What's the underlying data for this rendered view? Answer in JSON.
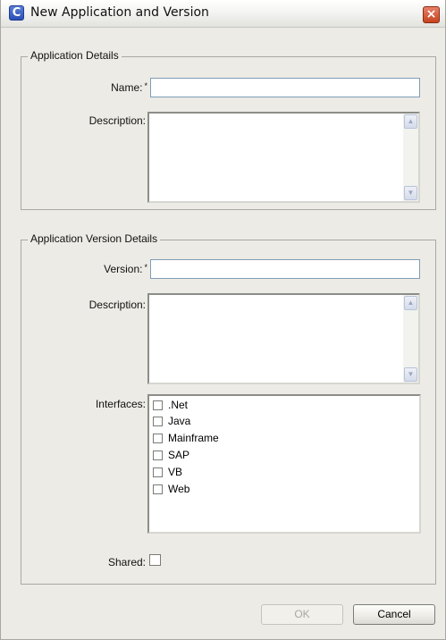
{
  "window": {
    "title": "New Application and Version",
    "icon_glyph": "C",
    "close_glyph": "×"
  },
  "app_details": {
    "group_title": "Application Details",
    "name_label": "Name:",
    "name_value": "",
    "description_label": "Description:",
    "description_value": ""
  },
  "version_details": {
    "group_title": "Application Version Details",
    "version_label": "Version:",
    "version_value": "",
    "description_label": "Description:",
    "description_value": "",
    "interfaces_label": "Interfaces:",
    "interfaces": [
      {
        "label": ".Net",
        "checked": false
      },
      {
        "label": "Java",
        "checked": false
      },
      {
        "label": "Mainframe",
        "checked": false
      },
      {
        "label": "SAP",
        "checked": false
      },
      {
        "label": "VB",
        "checked": false
      },
      {
        "label": "Web",
        "checked": false
      }
    ],
    "shared_label": "Shared:",
    "shared_checked": false
  },
  "required_marker": "*",
  "scroll_up_glyph": "▲",
  "scroll_down_glyph": "▼",
  "buttons": {
    "ok_label": "OK",
    "ok_enabled": false,
    "cancel_label": "Cancel"
  },
  "colors": {
    "dialog_bg": "#ecebe5",
    "field_border": "#7f9db9",
    "close_button": "#c5441f"
  }
}
